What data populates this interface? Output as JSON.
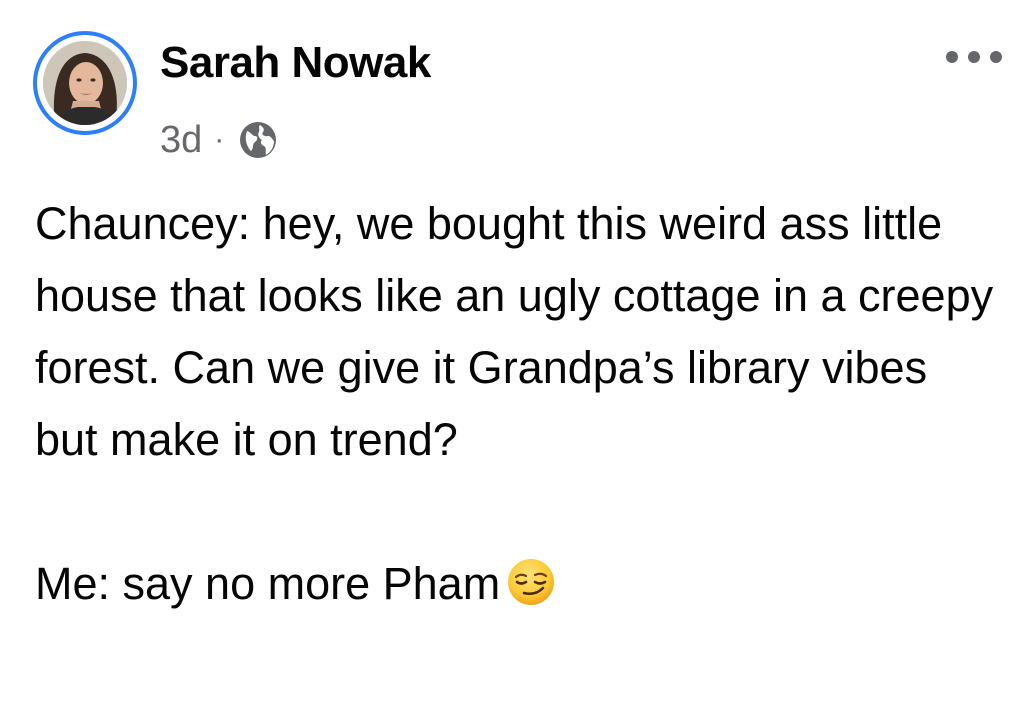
{
  "author": {
    "name": "Sarah Nowak"
  },
  "post": {
    "age": "3d",
    "separator": "·",
    "audience_icon": "globe-icon",
    "paragraphs": [
      "Chauncey: hey, we bought this weird ass little house that looks like an ugly cottage in a creepy forest. Can we give it Grandpa’s library vibes but make it on trend?",
      "Me: say no more Pham"
    ],
    "emoji": "smirking-face-icon"
  },
  "menu": {
    "icon": "more-options-icon"
  },
  "colors": {
    "avatar_ring": "#2d7ff9",
    "secondary_text": "#65676b",
    "primary_text": "#050505"
  }
}
